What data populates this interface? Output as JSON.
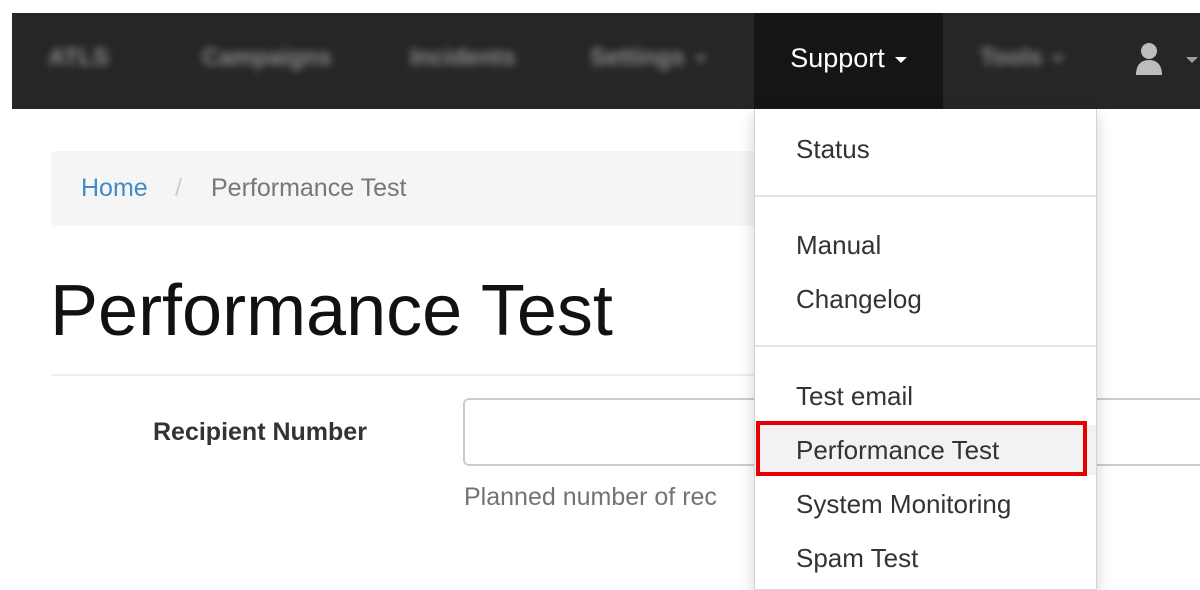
{
  "navbar": {
    "brand": "ATLS",
    "items": [
      {
        "label": "Campaigns"
      },
      {
        "label": "Incidents"
      },
      {
        "label": "Settings"
      },
      {
        "label": "Support"
      },
      {
        "label": "Tools"
      }
    ]
  },
  "breadcrumb": {
    "home": "Home",
    "separator": "/",
    "current": "Performance Test"
  },
  "page": {
    "title": "Performance Test"
  },
  "form": {
    "recipient_label": "Recipient Number",
    "recipient_value": "",
    "help_text": "Planned number of rec"
  },
  "dropdown": {
    "items": [
      {
        "label": "Status"
      },
      {
        "label": "Manual"
      },
      {
        "label": "Changelog"
      },
      {
        "label": "Test email"
      },
      {
        "label": "Performance Test"
      },
      {
        "label": "System Monitoring"
      },
      {
        "label": "Spam Test"
      }
    ]
  },
  "colors": {
    "navbar_bg": "#262626",
    "active_bg": "#151515",
    "link": "#428bca",
    "highlight_border": "#e60000"
  },
  "icons": {
    "user": "user-icon",
    "caret": "caret-down-icon"
  }
}
